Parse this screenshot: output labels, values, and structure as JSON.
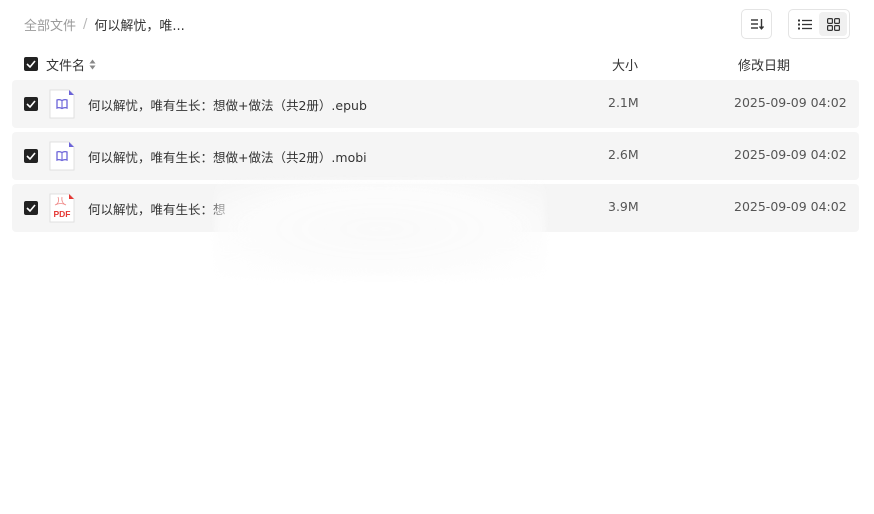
{
  "breadcrumb": {
    "root": "全部文件",
    "separator": "/",
    "current": "何以解忧，唯..."
  },
  "toolbar": {
    "sort_icon": "sort-icon",
    "list_view_icon": "list-view-icon",
    "grid_view_icon": "grid-view-icon",
    "active_view": "grid"
  },
  "table": {
    "columns": {
      "name": "文件名",
      "size": "大小",
      "modified": "修改日期"
    },
    "rows": [
      {
        "name": "何以解忧，唯有生长：想做+做法（共2册）.epub",
        "size": "2.1M",
        "modified": "2025-09-09 04:02",
        "icon": "ebook-icon",
        "checked": true
      },
      {
        "name": "何以解忧，唯有生长：想做+做法（共2册）.mobi",
        "size": "2.6M",
        "modified": "2025-09-09 04:02",
        "icon": "ebook-icon",
        "checked": true
      },
      {
        "name": "何以解忧，唯有生长：想",
        "size": "3.9M",
        "modified": "2025-09-09 04:02",
        "icon": "pdf-icon",
        "icon_text": "PDF",
        "checked": true
      }
    ]
  },
  "colors": {
    "row_bg": "#f5f5f5",
    "ebook_icon": "#6b63d9",
    "pdf_icon": "#e53935",
    "checkbox": "#222222"
  }
}
